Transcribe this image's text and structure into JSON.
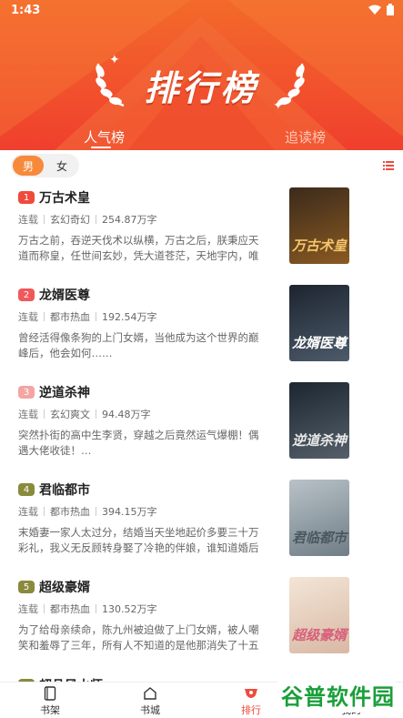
{
  "status_bar": {
    "time": "1:43"
  },
  "header": {
    "title": "排行榜",
    "tabs": [
      {
        "label": "人气榜",
        "active": true
      },
      {
        "label": "追读榜",
        "active": false
      }
    ]
  },
  "filter": {
    "gender_options": [
      {
        "label": "男",
        "active": true
      },
      {
        "label": "女",
        "active": false
      }
    ]
  },
  "books": [
    {
      "rank": "1",
      "rank_color": "#f04a3c",
      "title": "万古术皇",
      "status": "连载",
      "category": "玄幻奇幻",
      "words": "254.87万字",
      "desc": "万古之前，吞逆天伐术以纵横，万古之后，朕秉应天道而称皇，任世间玄妙，凭大道苍茫，天地宇内，唯我术道…",
      "cover_title": "万古术皇",
      "cover_bg": [
        "#3b2a1b",
        "#8a5a22"
      ],
      "cover_color": "#f4c56a"
    },
    {
      "rank": "2",
      "rank_color": "#f0595b",
      "title": "龙婿医尊",
      "status": "连载",
      "category": "都市热血",
      "words": "192.54万字",
      "desc": "曾经活得像条狗的上门女婿，当他成为这个世界的巅峰后，他会如何……",
      "cover_title": "龙婿医尊",
      "cover_bg": [
        "#1d2430",
        "#4d5b6a"
      ],
      "cover_color": "#ffffff"
    },
    {
      "rank": "3",
      "rank_color": "#f5a4a4",
      "title": "逆道杀神",
      "status": "连载",
      "category": "玄幻爽文",
      "words": "94.48万字",
      "desc": "突然扑街的高中生李贤，穿越之后竟然运气爆棚！偶遇大佬收徒！…",
      "cover_title": "逆道杀神",
      "cover_bg": [
        "#1c2630",
        "#55606a"
      ],
      "cover_color": "#e8e8e8"
    },
    {
      "rank": "4",
      "rank_color": "#8a8a3c",
      "title": "君临都市",
      "status": "连载",
      "category": "都市热血",
      "words": "394.15万字",
      "desc": "末婚妻一家人太过分，结婚当天坐地起价多要三十万彩礼，我义无反顾转身娶了冷艳的伴娘，谁知道婚后惊喜…",
      "cover_title": "君临都市",
      "cover_bg": [
        "#b9c2c8",
        "#6f7d86"
      ],
      "cover_color": "#4c5860"
    },
    {
      "rank": "5",
      "rank_color": "#8a8a3c",
      "title": "超级豪婿",
      "status": "连载",
      "category": "都市热血",
      "words": "130.52万字",
      "desc": "为了给母亲续命，陈九州被迫做了上门女婿，被人嘲笑和羞辱了三年，所有人不知道的是他那消失了十五年的父…",
      "cover_title": "超级豪婿",
      "cover_bg": [
        "#f3e5d7",
        "#d8b8a3"
      ],
      "cover_color": "#d85f7a"
    }
  ],
  "partial_book_title": "超品风水师",
  "bottom_nav": [
    {
      "label": "书架",
      "icon": "bookshelf-icon",
      "active": false
    },
    {
      "label": "书城",
      "icon": "bookstore-icon",
      "active": false
    },
    {
      "label": "排行",
      "icon": "ranking-icon",
      "active": true
    },
    {
      "label": "我的",
      "icon": "profile-icon",
      "active": false
    }
  ],
  "watermark": {
    "text": "谷普软件园"
  },
  "colors": {
    "accent": "#f04a3c",
    "header_top": "#f36a2a",
    "header_bottom": "#ef3f2d",
    "toggle_active": "#f7893a"
  }
}
